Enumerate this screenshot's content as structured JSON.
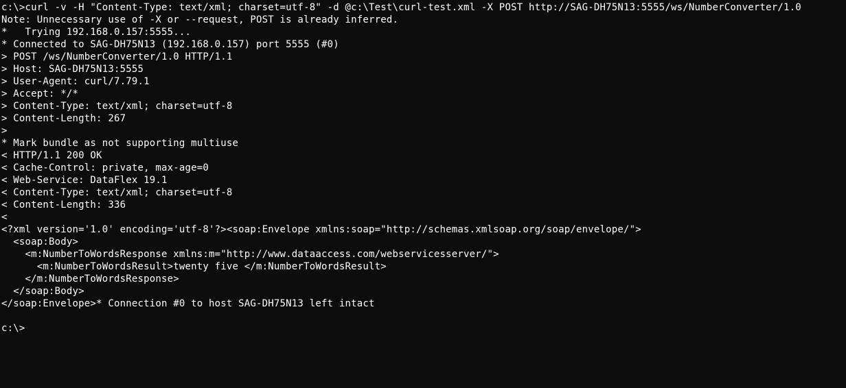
{
  "terminal": {
    "lines": [
      "c:\\>curl -v -H \"Content-Type: text/xml; charset=utf-8\" -d @c:\\Test\\curl-test.xml -X POST http://SAG-DH75N13:5555/ws/NumberConverter/1.0",
      "Note: Unnecessary use of -X or --request, POST is already inferred.",
      "*   Trying 192.168.0.157:5555...",
      "* Connected to SAG-DH75N13 (192.168.0.157) port 5555 (#0)",
      "> POST /ws/NumberConverter/1.0 HTTP/1.1",
      "> Host: SAG-DH75N13:5555",
      "> User-Agent: curl/7.79.1",
      "> Accept: */*",
      "> Content-Type: text/xml; charset=utf-8",
      "> Content-Length: 267",
      ">",
      "* Mark bundle as not supporting multiuse",
      "< HTTP/1.1 200 OK",
      "< Cache-Control: private, max-age=0",
      "< Web-Service: DataFlex 19.1",
      "< Content-Type: text/xml; charset=utf-8",
      "< Content-Length: 336",
      "<",
      "<?xml version='1.0' encoding='utf-8'?><soap:Envelope xmlns:soap=\"http://schemas.xmlsoap.org/soap/envelope/\">",
      "  <soap:Body>",
      "    <m:NumberToWordsResponse xmlns:m=\"http://www.dataaccess.com/webservicesserver/\">",
      "      <m:NumberToWordsResult>twenty five </m:NumberToWordsResult>",
      "    </m:NumberToWordsResponse>",
      "  </soap:Body>",
      "</soap:Envelope>* Connection #0 to host SAG-DH75N13 left intact",
      "",
      "c:\\>"
    ]
  }
}
